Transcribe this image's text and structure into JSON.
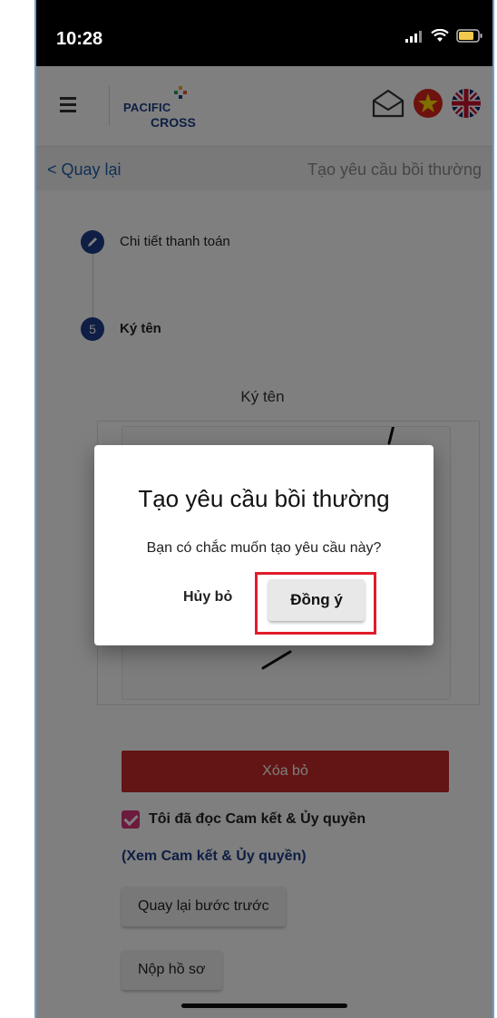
{
  "status_bar": {
    "time": "10:28"
  },
  "header": {
    "logo_line1": "PACIFIC",
    "logo_line2": "CROSS",
    "icons": [
      "menu-icon",
      "mail-icon",
      "flag-vietnam-icon",
      "flag-uk-icon"
    ]
  },
  "subheader": {
    "back_label": "< Quay lại",
    "title": "Tạo yêu cầu bồi thường"
  },
  "stepper": {
    "step_payment_label": "Chi tiết thanh toán",
    "step_sign_number": "5",
    "step_sign_label": "Ký tên"
  },
  "signature": {
    "title": "Ký tên"
  },
  "actions": {
    "delete_label": "Xóa bỏ",
    "agree_label": "Tôi đã đọc Cam kết & Ủy quyền",
    "agree_checked": true,
    "view_link": "(Xem Cam kết & Ủy quyền)",
    "back_step_label": "Quay lại bước trước",
    "submit_label": "Nộp hồ sơ"
  },
  "dialog": {
    "title": "Tạo yêu cầu bồi thường",
    "message": "Bạn có chắc muốn tạo yêu cầu này?",
    "cancel_label": "Hủy bỏ",
    "confirm_label": "Đồng ý"
  },
  "colors": {
    "brand_navy": "#1c3c88",
    "delete_red": "#c62828",
    "checkbox_pink": "#d9347b",
    "highlight_red": "#e11d2a"
  }
}
